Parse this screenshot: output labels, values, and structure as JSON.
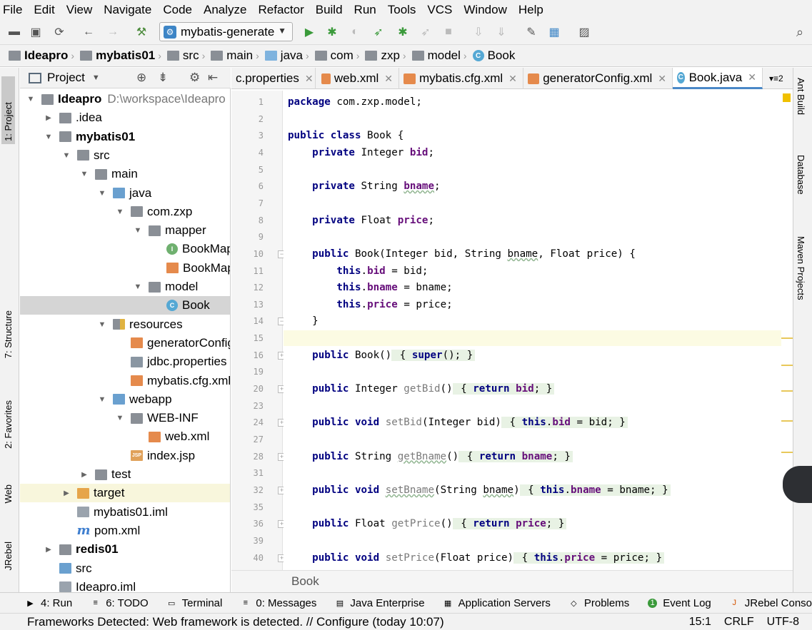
{
  "menu": [
    "File",
    "Edit",
    "View",
    "Navigate",
    "Code",
    "Analyze",
    "Refactor",
    "Build",
    "Run",
    "Tools",
    "VCS",
    "Window",
    "Help"
  ],
  "toolbar": {
    "run_config": "mybatis-generate"
  },
  "breadcrumbs": [
    "Ideapro",
    "mybatis01",
    "src",
    "main",
    "java",
    "com",
    "zxp",
    "model",
    "Book"
  ],
  "project_panel": {
    "title": "Project"
  },
  "tree": [
    {
      "label": "Ideapro",
      "extra": "D:\\workspace\\Ideapro",
      "depth": 0,
      "arrow": "down",
      "icon": "i-folder",
      "bold": true
    },
    {
      "label": ".idea",
      "depth": 1,
      "arrow": "right",
      "icon": "i-folder"
    },
    {
      "label": "mybatis01",
      "depth": 1,
      "arrow": "down",
      "icon": "i-folder",
      "bold": true
    },
    {
      "label": "src",
      "depth": 2,
      "arrow": "down",
      "icon": "i-folder"
    },
    {
      "label": "main",
      "depth": 3,
      "arrow": "down",
      "icon": "i-folder"
    },
    {
      "label": "java",
      "depth": 4,
      "arrow": "down",
      "icon": "i-src"
    },
    {
      "label": "com.zxp",
      "depth": 5,
      "arrow": "down",
      "icon": "i-pkg"
    },
    {
      "label": "mapper",
      "depth": 6,
      "arrow": "down",
      "icon": "i-pkg"
    },
    {
      "label": "BookMapper",
      "depth": 7,
      "arrow": "",
      "icon": "i-iface"
    },
    {
      "label": "BookMapper.xml",
      "depth": 7,
      "arrow": "",
      "icon": "i-xml"
    },
    {
      "label": "model",
      "depth": 6,
      "arrow": "down",
      "icon": "i-pkg"
    },
    {
      "label": "Book",
      "depth": 7,
      "arrow": "",
      "icon": "i-class",
      "selected": true
    },
    {
      "label": "resources",
      "depth": 4,
      "arrow": "down",
      "icon": "i-res"
    },
    {
      "label": "generatorConfig.xml",
      "depth": 5,
      "arrow": "",
      "icon": "i-xml"
    },
    {
      "label": "jdbc.properties",
      "depth": 5,
      "arrow": "",
      "icon": "i-prop"
    },
    {
      "label": "mybatis.cfg.xml",
      "depth": 5,
      "arrow": "",
      "icon": "i-xml"
    },
    {
      "label": "webapp",
      "depth": 4,
      "arrow": "down",
      "icon": "i-src"
    },
    {
      "label": "WEB-INF",
      "depth": 5,
      "arrow": "down",
      "icon": "i-folder"
    },
    {
      "label": "web.xml",
      "depth": 6,
      "arrow": "",
      "icon": "i-xml"
    },
    {
      "label": "index.jsp",
      "depth": 5,
      "arrow": "",
      "icon": "i-jsp"
    },
    {
      "label": "test",
      "depth": 3,
      "arrow": "right",
      "icon": "i-folder"
    },
    {
      "label": "target",
      "depth": 2,
      "arrow": "right",
      "icon": "i-target",
      "highlight": true
    },
    {
      "label": "mybatis01.iml",
      "depth": 2,
      "arrow": "",
      "icon": "i-iml"
    },
    {
      "label": "pom.xml",
      "depth": 2,
      "arrow": "",
      "icon": "i-mvn"
    },
    {
      "label": "redis01",
      "depth": 1,
      "arrow": "right",
      "icon": "i-folder",
      "bold": true
    },
    {
      "label": "src",
      "depth": 1,
      "arrow": "",
      "icon": "i-src"
    },
    {
      "label": "Ideapro.iml",
      "depth": 1,
      "arrow": "",
      "icon": "i-iml"
    }
  ],
  "tabs": [
    {
      "label": "c.properties",
      "active": false
    },
    {
      "label": "web.xml",
      "active": false
    },
    {
      "label": "mybatis.cfg.xml",
      "active": false
    },
    {
      "label": "generatorConfig.xml",
      "active": false
    },
    {
      "label": "Book.java",
      "active": true
    }
  ],
  "tab_overflow": "2",
  "code": [
    {
      "n": "1",
      "html": "<span class='kw'>package</span> com.zxp.model;"
    },
    {
      "n": "2",
      "html": ""
    },
    {
      "n": "3",
      "html": "<span class='kw'>public class</span> Book {"
    },
    {
      "n": "4",
      "html": "    <span class='kw'>private</span> Integer <span class='fld'>bid</span>;"
    },
    {
      "n": "5",
      "html": ""
    },
    {
      "n": "6",
      "html": "    <span class='kw'>private</span> String <span class='fld un'>bname</span>;"
    },
    {
      "n": "7",
      "html": ""
    },
    {
      "n": "8",
      "html": "    <span class='kw'>private</span> Float <span class='fld'>price</span>;"
    },
    {
      "n": "9",
      "html": ""
    },
    {
      "n": "10",
      "html": "    <span class='kw'>public</span> Book(Integer bid, String <span class='un'>bname</span>, Float price) {"
    },
    {
      "n": "11",
      "html": "        <span class='kw'>this</span>.<span class='fld'>bid</span> = bid;"
    },
    {
      "n": "12",
      "html": "        <span class='kw'>this</span>.<span class='fld'>bname</span> = bname;"
    },
    {
      "n": "13",
      "html": "        <span class='kw'>this</span>.<span class='fld'>price</span> = price;"
    },
    {
      "n": "14",
      "html": "    }"
    },
    {
      "n": "15",
      "html": "",
      "current": true
    },
    {
      "n": "16",
      "html": "    <span class='kw'>public</span> Book()<span class='bx'> { <span class='kw'>super</span>(); }</span>"
    },
    {
      "n": "19",
      "html": ""
    },
    {
      "n": "20",
      "html": "    <span class='kw'>public</span> Integer <span class='gr'>getBid</span>()<span class='bx'> { <span class='kw'>return</span> <span class='fld'>bid</span>; }</span>"
    },
    {
      "n": "23",
      "html": ""
    },
    {
      "n": "24",
      "html": "    <span class='kw'>public void</span> <span class='gr'>setBid</span>(Integer bid)<span class='bx'> { <span class='kw'>this</span>.<span class='fld'>bid</span> = bid; }</span>"
    },
    {
      "n": "27",
      "html": ""
    },
    {
      "n": "28",
      "html": "    <span class='kw'>public</span> String <span class='gr un'>getBname</span>()<span class='bx'> { <span class='kw'>return</span> <span class='fld'>bname</span>; }</span>"
    },
    {
      "n": "31",
      "html": ""
    },
    {
      "n": "32",
      "html": "    <span class='kw'>public void</span> <span class='gr un'>setBname</span>(String <span class='un'>bname</span>)<span class='bx'> { <span class='kw'>this</span>.<span class='fld'>bname</span> = bname; }</span>"
    },
    {
      "n": "35",
      "html": ""
    },
    {
      "n": "36",
      "html": "    <span class='kw'>public</span> Float <span class='gr'>getPrice</span>()<span class='bx'> { <span class='kw'>return</span> <span class='fld'>price</span>; }</span>"
    },
    {
      "n": "39",
      "html": ""
    },
    {
      "n": "40",
      "html": "    <span class='kw'>public void</span> <span class='gr'>setPrice</span>(Float price)<span class='bx'> { <span class='kw'>this</span>.<span class='fld'>price</span> = price; }</span>"
    }
  ],
  "editor_breadcrumb": "Book",
  "left_tool_tabs": [
    "1: Project",
    "7: Structure",
    "2: Favorites",
    "Web",
    "JRebel"
  ],
  "right_tool_tabs": [
    "Ant Build",
    "Database",
    "Maven Projects"
  ],
  "bottom_tools": [
    {
      "label": "4: Run",
      "icon": "▶"
    },
    {
      "label": "6: TODO",
      "icon": "≡"
    },
    {
      "label": "Terminal",
      "icon": "▭"
    },
    {
      "label": "0: Messages",
      "icon": "≡"
    },
    {
      "label": "Java Enterprise",
      "icon": "▤"
    },
    {
      "label": "Application Servers",
      "icon": "▦"
    },
    {
      "label": "Problems",
      "icon": "◇"
    },
    {
      "label": "Event Log",
      "icon": "1"
    },
    {
      "label": "JRebel Console",
      "icon": "J"
    }
  ],
  "status": {
    "message": "Frameworks Detected: Web framework is detected. // Configure (today 10:07)",
    "position": "15:1",
    "line_sep": "CRLF",
    "encoding": "UTF-8"
  },
  "colors": {
    "keyword": "#000080",
    "field": "#660e7a",
    "accent": "#4a88c7"
  }
}
